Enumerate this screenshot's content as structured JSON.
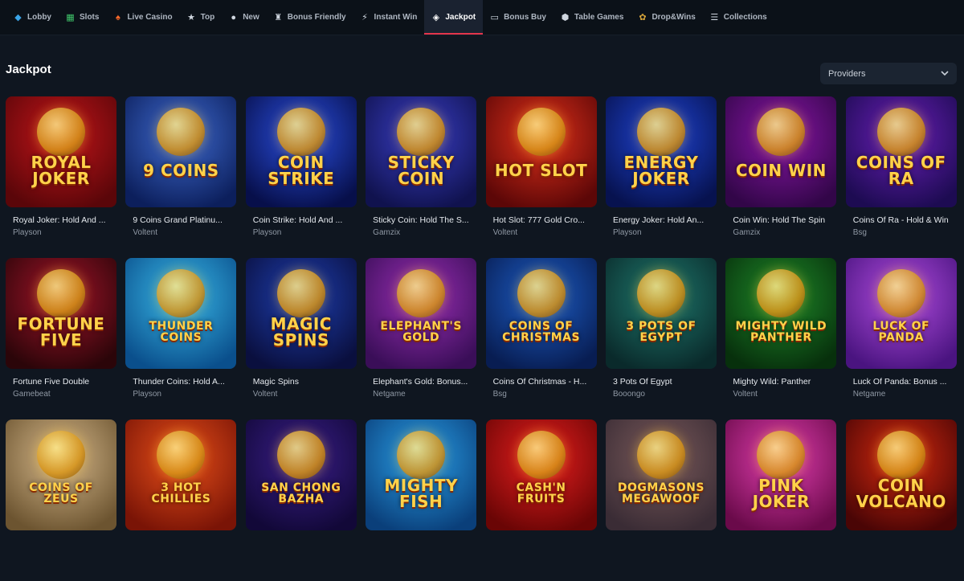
{
  "nav": {
    "items": [
      {
        "label": "Lobby",
        "icon": "lobby-icon",
        "active": false
      },
      {
        "label": "Slots",
        "icon": "slots-icon",
        "active": false
      },
      {
        "label": "Live Casino",
        "icon": "live-casino-icon",
        "active": false
      },
      {
        "label": "Top",
        "icon": "star-icon",
        "active": false
      },
      {
        "label": "New",
        "icon": "new-icon",
        "active": false
      },
      {
        "label": "Bonus Friendly",
        "icon": "bonus-icon",
        "active": false
      },
      {
        "label": "Instant Win",
        "icon": "lightning-icon",
        "active": false
      },
      {
        "label": "Jackpot",
        "icon": "diamond-icon",
        "active": true
      },
      {
        "label": "Bonus Buy",
        "icon": "card-icon",
        "active": false
      },
      {
        "label": "Table Games",
        "icon": "dice-icon",
        "active": false
      },
      {
        "label": "Drop&Wins",
        "icon": "gift-icon",
        "active": false
      },
      {
        "label": "Collections",
        "icon": "collections-icon",
        "active": false
      }
    ],
    "accent": "#e3354b"
  },
  "page": {
    "title": "Jackpot",
    "providers_label": "Providers"
  },
  "games": [
    {
      "name": "Royal Joker: Hold And ...",
      "provider": "Playson",
      "logo": "ROYAL JOKER",
      "bg": [
        "#c3151a",
        "#5a0609"
      ]
    },
    {
      "name": "9 Coins Grand Platinu...",
      "provider": "Voltent",
      "logo": "9 COINS",
      "bg": [
        "#3f6bd0",
        "#0c1f5c"
      ]
    },
    {
      "name": "Coin Strike: Hold And ...",
      "provider": "Playson",
      "logo": "COIN STRIKE",
      "bg": [
        "#2a4fe0",
        "#070f4a"
      ]
    },
    {
      "name": "Sticky Coin: Hold The S...",
      "provider": "Gamzix",
      "logo": "STICKY COIN",
      "bg": [
        "#3a3fc7",
        "#10124e"
      ]
    },
    {
      "name": "Hot Slot: 777 Gold Cro...",
      "provider": "Voltent",
      "logo": "HOT SLOT",
      "bg": [
        "#e2311b",
        "#5c0707"
      ]
    },
    {
      "name": "Energy Joker: Hold An...",
      "provider": "Playson",
      "logo": "ENERGY JOKER",
      "bg": [
        "#1f45d6",
        "#07124f"
      ]
    },
    {
      "name": "Coin Win: Hold The Spin",
      "provider": "Gamzix",
      "logo": "COIN WIN",
      "bg": [
        "#8a16a8",
        "#320648"
      ]
    },
    {
      "name": "Coins Of Ra - Hold & Win",
      "provider": "Bsg",
      "logo": "COINS OF RA",
      "bg": [
        "#6a1fb8",
        "#1d0b52"
      ]
    },
    {
      "name": "Fortune Five Double",
      "provider": "Gamebeat",
      "logo": "FORTUNE FIVE",
      "bg": [
        "#a4142a",
        "#2b0509"
      ]
    },
    {
      "name": "Thunder Coins: Hold A...",
      "provider": "Playson",
      "logo": "THUNDER COINS",
      "bg": [
        "#39b9e8",
        "#0a4f8c"
      ]
    },
    {
      "name": "Magic Spins",
      "provider": "Voltent",
      "logo": "MAGIC SPINS",
      "bg": [
        "#1e3fb0",
        "#0a0f3e"
      ]
    },
    {
      "name": "Elephant's Gold: Bonus...",
      "provider": "Netgame",
      "logo": "ELEPHANT'S GOLD",
      "bg": [
        "#9a2fb5",
        "#3a0e58"
      ]
    },
    {
      "name": "Coins Of Christmas - H...",
      "provider": "Bsg",
      "logo": "COINS OF CHRISTMAS",
      "bg": [
        "#1d5ec7",
        "#081d52"
      ]
    },
    {
      "name": "3 Pots Of Egypt",
      "provider": "Booongo",
      "logo": "3 POTS OF EGYPT",
      "bg": [
        "#1f7a6e",
        "#0a2a2b"
      ]
    },
    {
      "name": "Mighty Wild: Panther",
      "provider": "Voltent",
      "logo": "MIGHTY WILD PANTHER",
      "bg": [
        "#1f8a2a",
        "#07300c"
      ]
    },
    {
      "name": "Luck Of Panda: Bonus ...",
      "provider": "Netgame",
      "logo": "LUCK OF PANDA",
      "bg": [
        "#b24de0",
        "#4a1480"
      ]
    },
    {
      "name": "",
      "provider": "",
      "logo": "COINS OF ZEUS",
      "bg": [
        "#d6b98c",
        "#6c5430"
      ]
    },
    {
      "name": "",
      "provider": "",
      "logo": "3 HOT CHILLIES",
      "bg": [
        "#e8501a",
        "#7a1406"
      ]
    },
    {
      "name": "",
      "provider": "",
      "logo": "SAN CHONG BAZHA",
      "bg": [
        "#3a1f8a",
        "#120838"
      ]
    },
    {
      "name": "",
      "provider": "",
      "logo": "MIGHTY FISH",
      "bg": [
        "#2aa0e8",
        "#0a3f7a"
      ]
    },
    {
      "name": "",
      "provider": "",
      "logo": "CASH'N FRUITS",
      "bg": [
        "#e81f1f",
        "#6a0505"
      ]
    },
    {
      "name": "",
      "provider": "",
      "logo": "DOGMASONS MEGAWOOF",
      "bg": [
        "#7a5a5a",
        "#3a2c35"
      ]
    },
    {
      "name": "",
      "provider": "",
      "logo": "PINK JOKER",
      "bg": [
        "#e23fb0",
        "#6a0a4a"
      ]
    },
    {
      "name": "",
      "provider": "",
      "logo": "COIN VOLCANO",
      "bg": [
        "#d62a10",
        "#4a0505"
      ]
    }
  ]
}
